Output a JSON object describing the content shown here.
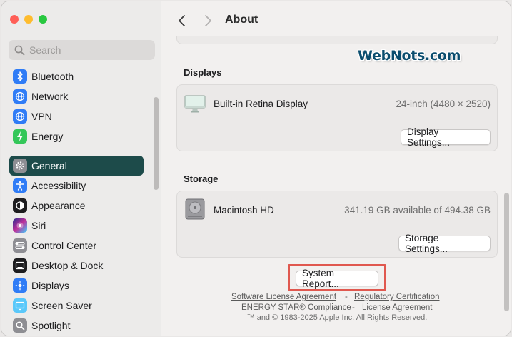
{
  "window": {
    "traffic_lights": [
      "#ff5f57",
      "#febc2e",
      "#28c840"
    ]
  },
  "sidebar": {
    "search_placeholder": "Search",
    "items": [
      {
        "label": "Bluetooth",
        "icon": "bluetooth-icon",
        "color": "#2f7cf6"
      },
      {
        "label": "Network",
        "icon": "network-icon",
        "color": "#2f7cf6"
      },
      {
        "label": "VPN",
        "icon": "vpn-icon",
        "color": "#2f7cf6"
      },
      {
        "label": "Energy",
        "icon": "energy-icon",
        "color": "#34c759"
      },
      {
        "label": "General",
        "icon": "gear-icon",
        "color": "#8e8e93",
        "active": true
      },
      {
        "label": "Accessibility",
        "icon": "accessibility-icon",
        "color": "#2f7cf6"
      },
      {
        "label": "Appearance",
        "icon": "appearance-icon",
        "color": "#1d1d1f"
      },
      {
        "label": "Siri",
        "icon": "siri-icon",
        "color": "#6b3fd1"
      },
      {
        "label": "Control Center",
        "icon": "control-center-icon",
        "color": "#8e8e93"
      },
      {
        "label": "Desktop & Dock",
        "icon": "desktop-dock-icon",
        "color": "#1d1d1f"
      },
      {
        "label": "Displays",
        "icon": "displays-icon",
        "color": "#2f7cf6"
      },
      {
        "label": "Screen Saver",
        "icon": "screen-saver-icon",
        "color": "#5ac8fa"
      },
      {
        "label": "Spotlight",
        "icon": "spotlight-icon",
        "color": "#8e8e93"
      }
    ]
  },
  "header": {
    "title": "About"
  },
  "watermark": "WebNots.com",
  "displays": {
    "section_title": "Displays",
    "name": "Built-in Retina Display",
    "spec": "24-inch (4480 × 2520)",
    "button": "Display Settings..."
  },
  "storage": {
    "section_title": "Storage",
    "name": "Macintosh HD",
    "spec": "341.19 GB available of 494.38 GB",
    "button": "Storage Settings..."
  },
  "system_report_button": "System Report...",
  "footer": {
    "link1": "Software License Agreement",
    "link2": "Regulatory Certification",
    "link3": "ENERGY STAR® Compliance",
    "link4": "License Agreement",
    "separator": "-",
    "copyright": "™ and © 1983-2025 Apple Inc. All Rights Reserved."
  },
  "accent": {
    "selected": "#1d4b4a",
    "highlight_box": "#e0584f"
  }
}
